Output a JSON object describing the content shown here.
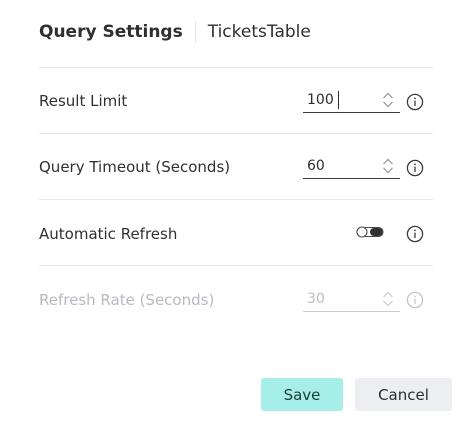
{
  "header": {
    "title": "Query Settings",
    "subtitle": "TicketsTable"
  },
  "settings": {
    "result_limit": {
      "label": "Result Limit",
      "value": "100",
      "enabled": true,
      "focused": true
    },
    "query_timeout": {
      "label": "Query Timeout (Seconds)",
      "value": "60",
      "enabled": true
    },
    "automatic_refresh": {
      "label": "Automatic Refresh",
      "toggle_on": false
    },
    "refresh_rate": {
      "label": "Refresh Rate (Seconds)",
      "value": "30",
      "enabled": false
    }
  },
  "actions": {
    "save_label": "Save",
    "cancel_label": "Cancel"
  },
  "colors": {
    "save_button": "#a6efe9",
    "cancel_button": "#eceef1",
    "disabled_text": "#b7bac0"
  },
  "icons": {
    "stepper": "chevron-up-down-icon",
    "info": "info-circle-icon",
    "toggle": "toggle-switch"
  }
}
